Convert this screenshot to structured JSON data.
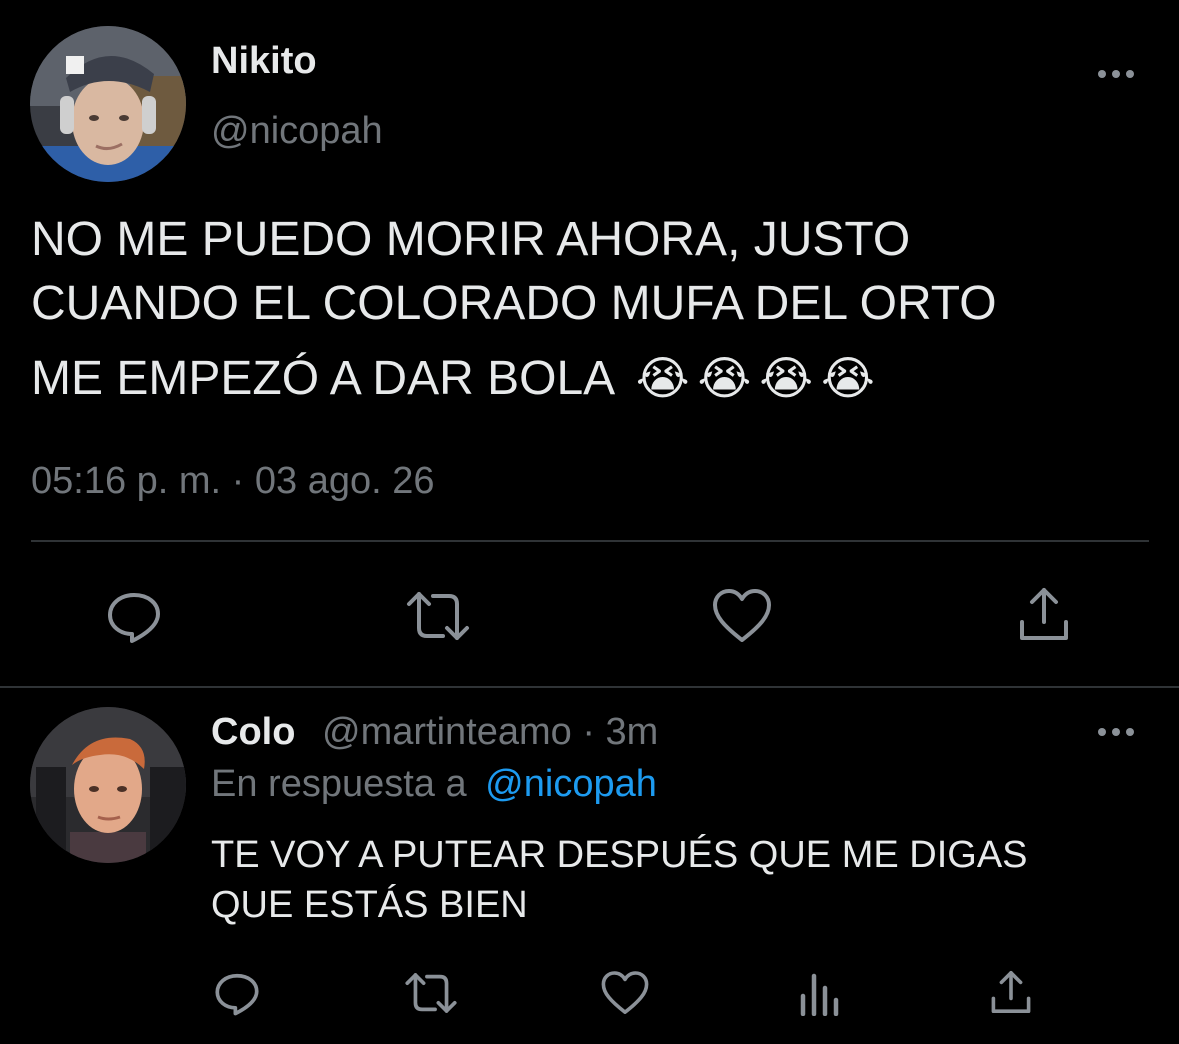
{
  "main_tweet": {
    "display_name": "Nikito",
    "handle": "@nicopah",
    "text_line1": "NO ME PUEDO MORIR AHORA, JUSTO",
    "text_line2": "CUANDO EL COLORADO MUFA DEL ORTO",
    "text_line3": "ME EMPEZÓ A DAR BOLA",
    "emoji": "😭😭😭😭",
    "timestamp": "05:16 p. m. · 03 ago. 26",
    "actions": {
      "reply_icon": "reply-icon",
      "retweet_icon": "retweet-icon",
      "like_icon": "heart-icon",
      "share_icon": "share-icon"
    }
  },
  "reply_tweet": {
    "display_name": "Colo",
    "handle_time": "@martinteamo · 3m",
    "reply_to_prefix": "En respuesta a",
    "reply_to_handle": "@nicopah",
    "text_line1": "TE VOY A PUTEAR DESPUÉS QUE ME DIGAS",
    "text_line2": "QUE ESTÁS BIEN",
    "actions": {
      "reply_icon": "reply-icon",
      "retweet_icon": "retweet-icon",
      "like_icon": "heart-icon",
      "analytics_icon": "analytics-icon",
      "share_icon": "share-icon"
    }
  },
  "colors": {
    "background": "#000000",
    "text": "#e7e9ea",
    "muted": "#71767b",
    "link": "#1d9bf0",
    "divider": "#2f3336"
  }
}
